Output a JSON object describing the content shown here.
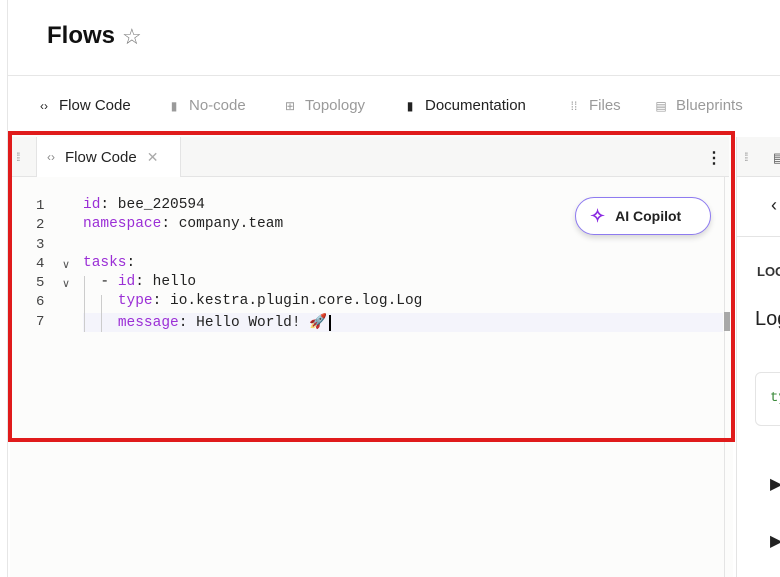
{
  "header": {
    "title": "Flows",
    "star_icon": "star-outline"
  },
  "tabs": [
    {
      "label": "Flow Code",
      "icon": "‹›",
      "active": true
    },
    {
      "label": "No-code",
      "icon": "🖱",
      "active": false
    },
    {
      "label": "Topology",
      "icon": "⊞",
      "active": false
    },
    {
      "label": "Documentation",
      "icon": "▮",
      "active": true
    },
    {
      "label": "Files",
      "icon": "⁞⁞",
      "active": false
    },
    {
      "label": "Blueprints",
      "icon": "▤",
      "active": false
    }
  ],
  "editor": {
    "tab_label": "Flow Code",
    "ai_button": "AI Copilot",
    "lines": [
      {
        "n": "1",
        "key": "id",
        "value": " bee_220594"
      },
      {
        "n": "2",
        "key": "namespace",
        "value": " company.team"
      },
      {
        "n": "3",
        "key": "",
        "value": ""
      },
      {
        "n": "4",
        "key": "tasks",
        "value": ""
      },
      {
        "n": "5",
        "prefix": "  - ",
        "key": "id",
        "value": " hello"
      },
      {
        "n": "6",
        "prefix": "    ",
        "key": "type",
        "value": " io.kestra.plugin.core.log.Log"
      },
      {
        "n": "7",
        "prefix": "    ",
        "key": "message",
        "value": " Hello World! 🚀"
      }
    ]
  },
  "docs": {
    "heading_small": "LOG",
    "heading": "Log",
    "code_snippet": "ty"
  }
}
